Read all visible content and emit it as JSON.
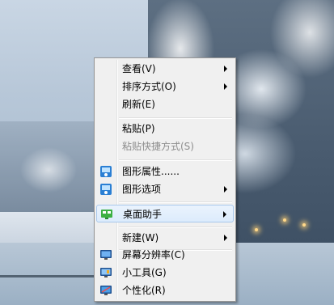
{
  "context_menu": {
    "items": [
      {
        "label": "查看(V)",
        "submenu": true
      },
      {
        "label": "排序方式(O)",
        "submenu": true
      },
      {
        "label": "刷新(E)"
      },
      {
        "label": "粘贴(P)"
      },
      {
        "label": "粘贴快捷方式(S)",
        "disabled": true
      },
      {
        "label": "图形属性......",
        "icon": "graphics-properties-icon"
      },
      {
        "label": "图形选项",
        "icon": "graphics-options-icon",
        "submenu": true
      },
      {
        "label": "桌面助手",
        "icon": "desktop-assistant-icon",
        "submenu": true
      },
      {
        "label": "新建(W)",
        "submenu": true
      },
      {
        "label": "屏幕分辨率(C)",
        "icon": "screen-resolution-icon"
      },
      {
        "label": "小工具(G)",
        "icon": "gadgets-icon"
      },
      {
        "label": "个性化(R)",
        "icon": "personalize-icon"
      }
    ]
  },
  "colors": {
    "menu_bg": "#f0f0f0",
    "hover_bg": "#dcebfc",
    "disabled_text": "#8d8d8d"
  }
}
